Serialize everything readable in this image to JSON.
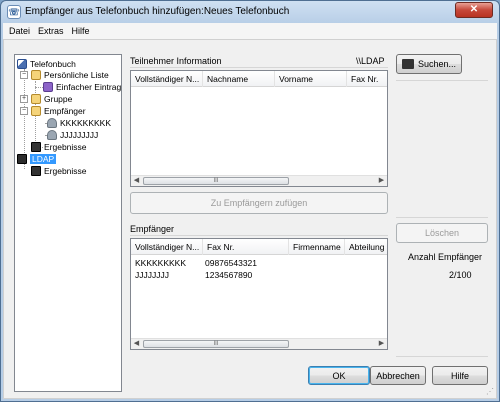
{
  "window": {
    "title": "Empfänger aus Telefonbuch hinzufügen:Neues Telefonbuch",
    "close_glyph": "✕"
  },
  "menu": [
    "Datei",
    "Extras",
    "Hilfe"
  ],
  "tree": {
    "root": "Telefonbuch",
    "personal_list": "Persönliche Liste",
    "simple_entry": "Einfacher Eintrag",
    "group": "Gruppe",
    "recipients": "Empfänger",
    "person1": "KKKKKKKKK",
    "person2": "JJJJJJJJJ",
    "results1": "Ergebnisse",
    "ldap": "LDAP",
    "results2": "Ergebnisse",
    "expand_glyph": "+",
    "collapse_glyph": "−"
  },
  "participant": {
    "label": "Teilnehmer Information",
    "ldap_path": "\\\\LDAP",
    "columns": [
      "Vollständiger N...",
      "Nachname",
      "Vorname",
      "Fax Nr."
    ],
    "rows": []
  },
  "buttons": {
    "search": "Suchen...",
    "add_to_recipients": "Zu Empfängern zufügen",
    "delete": "Löschen",
    "ok": "OK",
    "cancel": "Abbrechen",
    "help": "Hilfe"
  },
  "recipients": {
    "label": "Empfänger",
    "columns": [
      "Vollständiger N...",
      "Fax Nr.",
      "Firmenname",
      "Abteilung"
    ],
    "rows": [
      {
        "name": "KKKKKKKKK",
        "fax": "09876543321"
      },
      {
        "name": "JJJJJJJJ",
        "fax": "1234567890"
      }
    ],
    "count_label": "Anzahl Empfänger",
    "count_value": "2/100"
  },
  "scroll": {
    "left": "◀",
    "right": "▶",
    "thumb_grip": "III"
  },
  "icons": {
    "window": "phonebook-icon",
    "search": "binoculars-icon"
  }
}
